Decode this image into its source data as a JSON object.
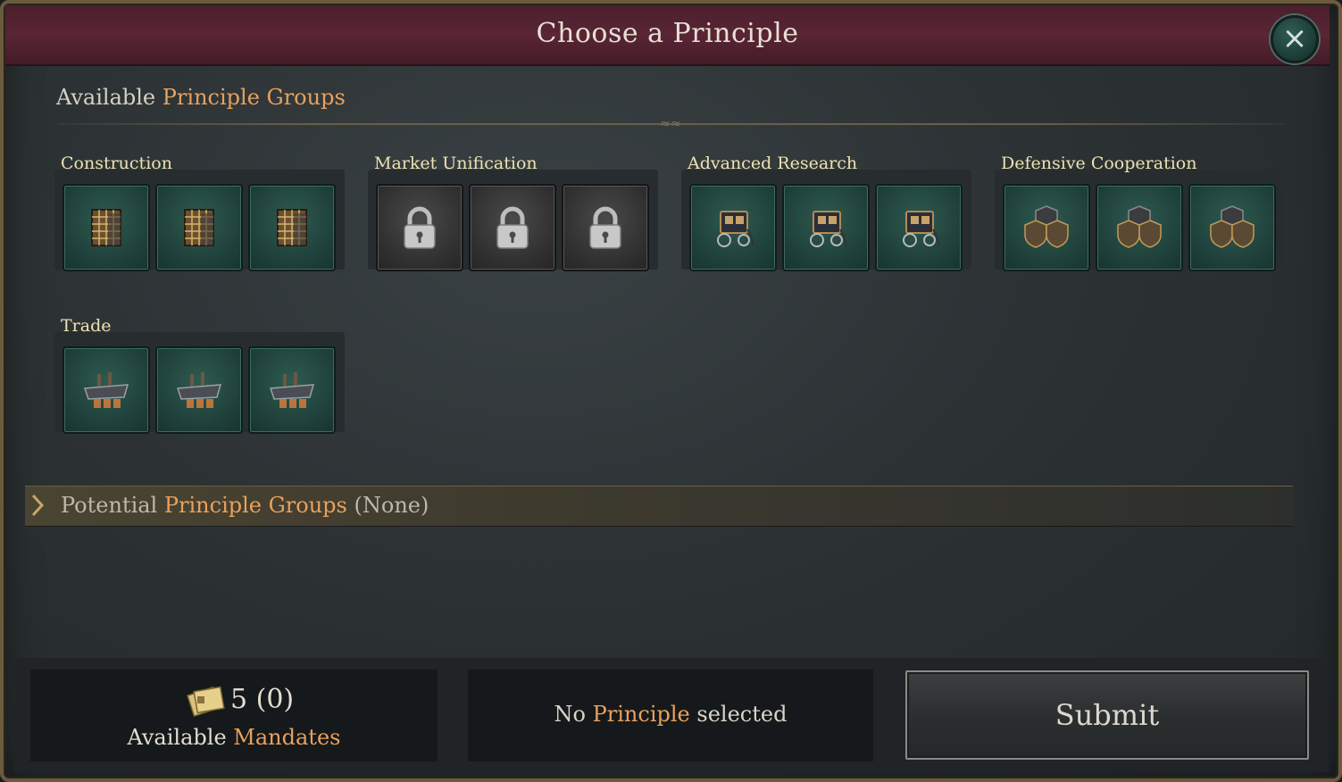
{
  "window": {
    "title": "Choose a Principle",
    "close_icon": "×"
  },
  "available": {
    "prefix": "Available",
    "accent": "Principle Groups"
  },
  "groups": [
    {
      "name": "Construction",
      "icon": "building-scaffold-icon",
      "locked": false
    },
    {
      "name": "Market Unification",
      "icon": "lock-icon",
      "locked": true
    },
    {
      "name": "Advanced Research",
      "icon": "carriage-icon",
      "locked": false
    },
    {
      "name": "Defensive Cooperation",
      "icon": "shields-icon",
      "locked": false
    },
    {
      "name": "Trade",
      "icon": "trade-ship-icon",
      "locked": false
    }
  ],
  "potential": {
    "prefix": "Potential",
    "accent": "Principle Groups",
    "suffix": "(None)"
  },
  "mandates": {
    "value": "5 (0)",
    "label_prefix": "Available",
    "label_accent": "Mandates",
    "icon": "mandate-papers-icon"
  },
  "selection": {
    "prefix": "No",
    "accent": "Principle",
    "suffix": "selected"
  },
  "submit": {
    "label": "Submit"
  },
  "colors": {
    "accent": "#e8a15c",
    "title_bar": "#5a2535",
    "tile_green": "#2e5a50"
  }
}
